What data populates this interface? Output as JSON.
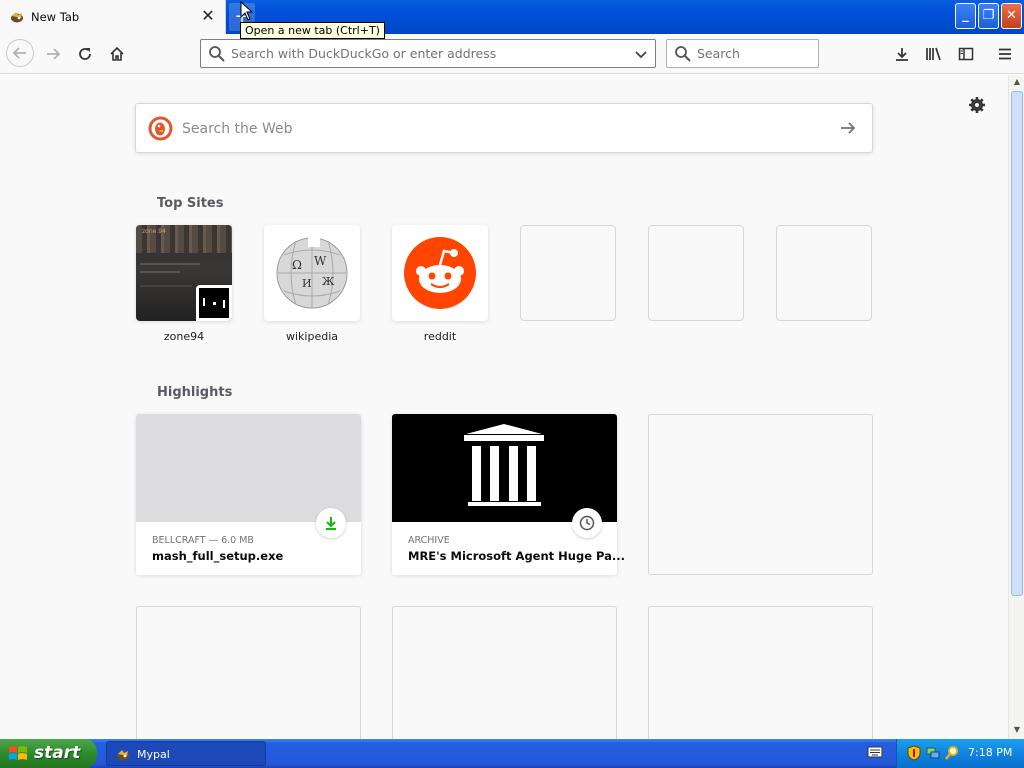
{
  "tab": {
    "title": "New Tab",
    "favicon": "mypal-icon"
  },
  "new_tab_tooltip": "Open a new tab (Ctrl+T)",
  "toolbar": {
    "url_placeholder": "Search with DuckDuckGo or enter address",
    "search_placeholder": "Search"
  },
  "newtab": {
    "web_search_placeholder": "Search the Web",
    "top_sites_title": "Top Sites",
    "top_sites": [
      {
        "label": "zone94",
        "thumb_text": "zone.94"
      },
      {
        "label": "wikipedia"
      },
      {
        "label": "reddit"
      },
      {
        "label": ""
      },
      {
        "label": ""
      },
      {
        "label": ""
      }
    ],
    "highlights_title": "Highlights",
    "highlights": [
      {
        "context": "BELLCRAFT — 6.0 MB",
        "title": "mash_full_setup.exe",
        "badge": "download-icon"
      },
      {
        "context": "ARCHIVE",
        "title": "MRE's Microsoft Agent Huge Pa...",
        "badge": "clock-icon"
      }
    ]
  },
  "taskbar": {
    "start_label": "start",
    "task_label": "Mypal",
    "clock": "7:18 PM"
  },
  "colors": {
    "reddit": "#ff4500",
    "accent_blue": "#0050d8",
    "start_green": "#2f8a2e"
  }
}
